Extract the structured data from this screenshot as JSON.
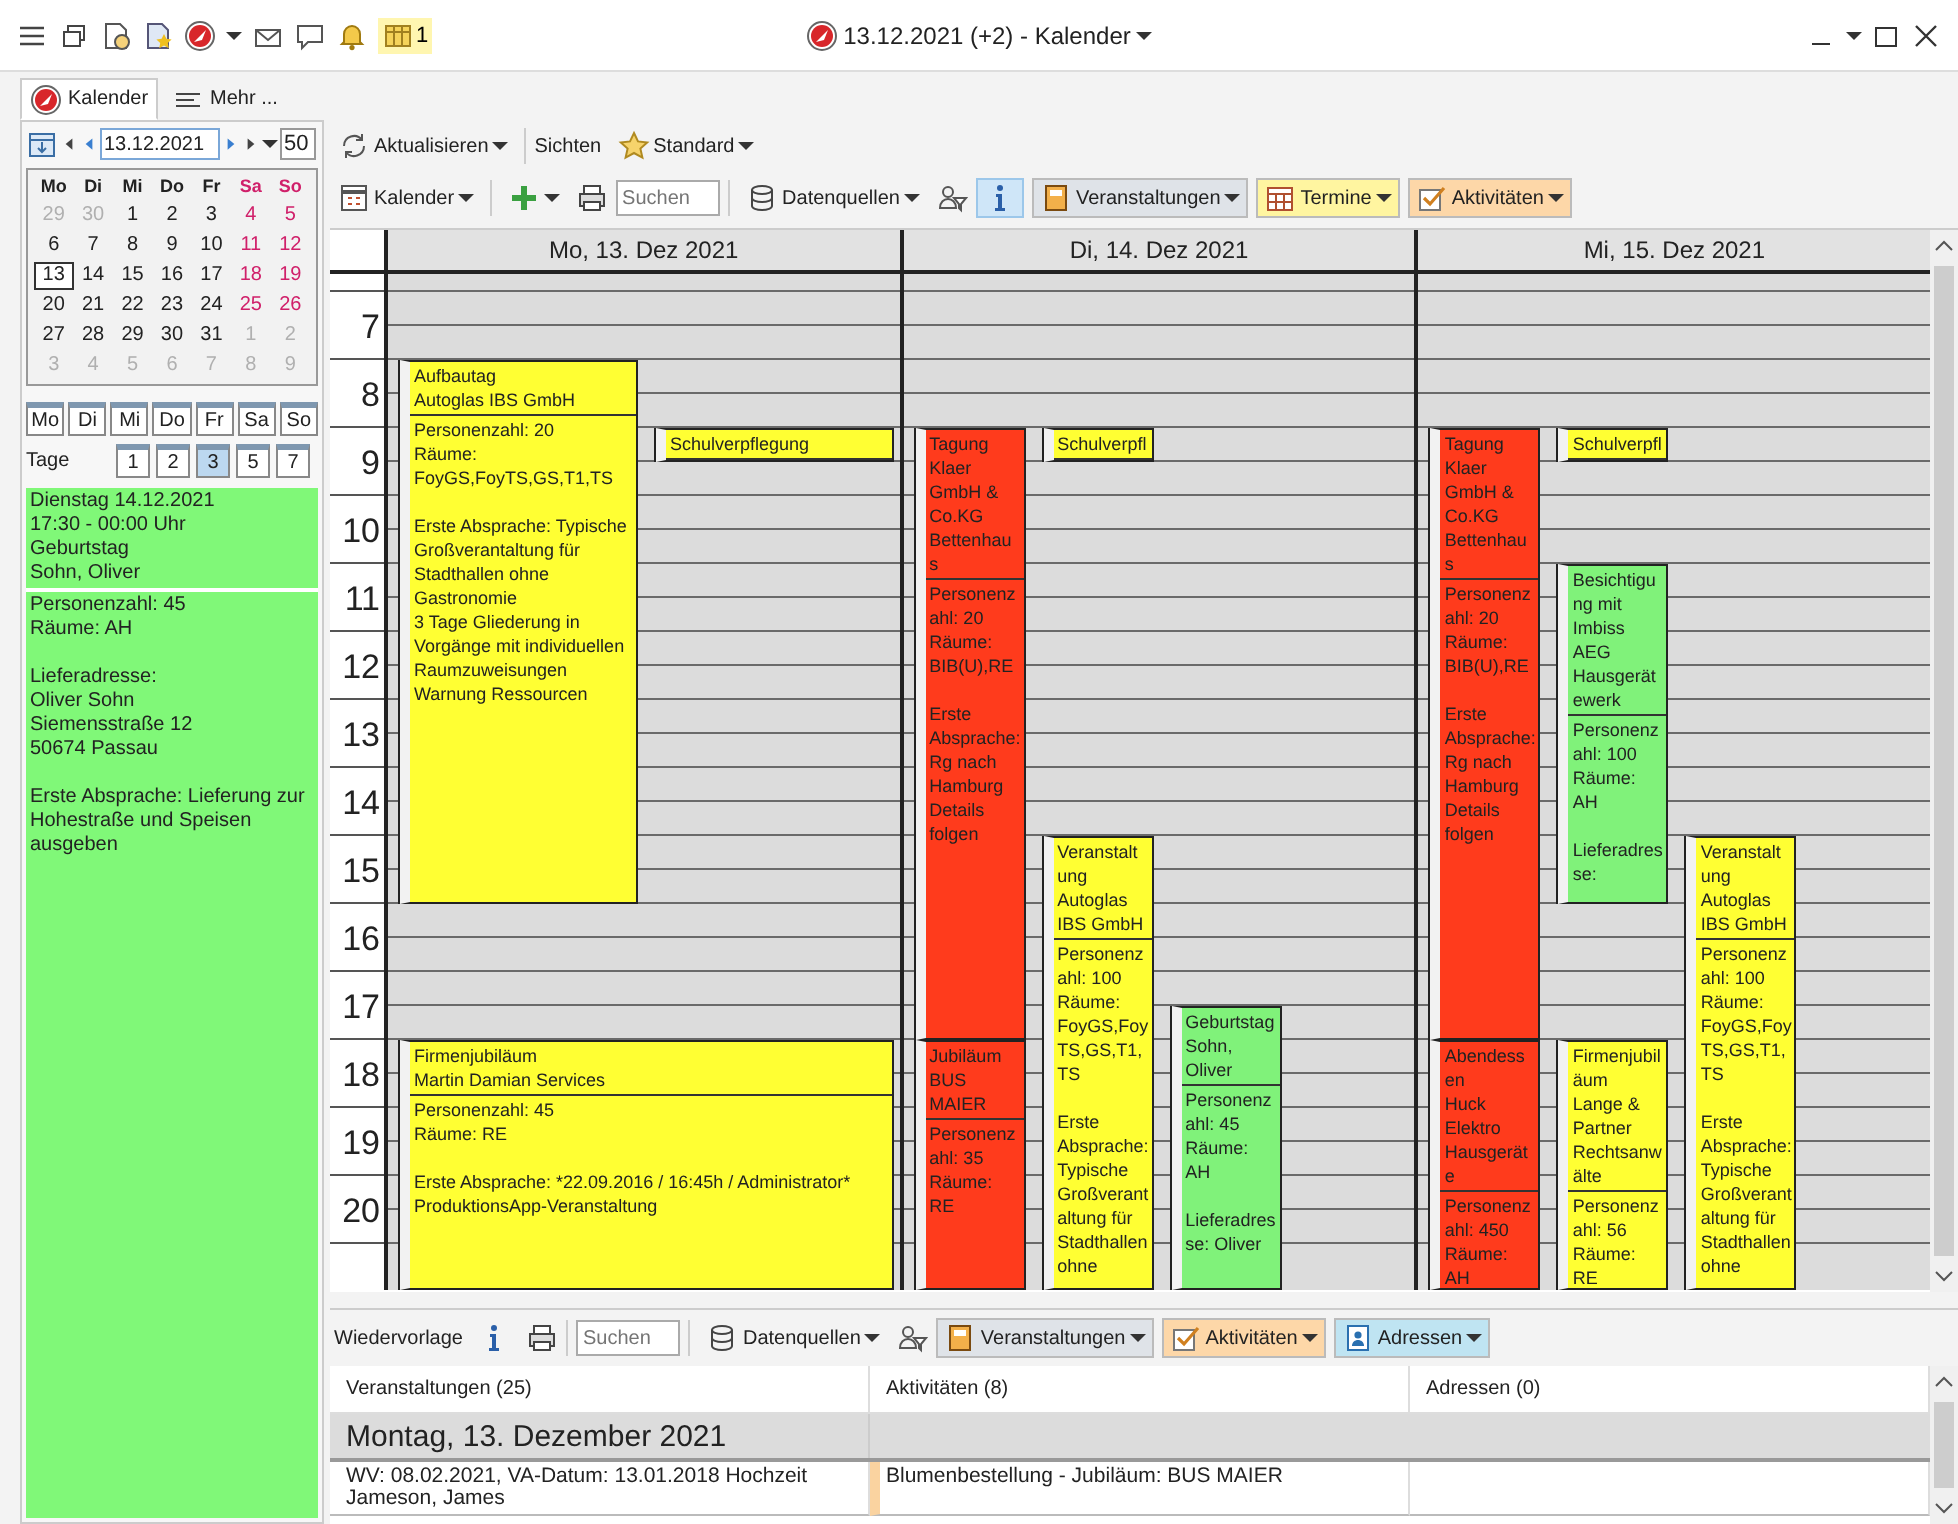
{
  "window": {
    "title": "13.12.2021 (+2) - Kalender",
    "badge": "1"
  },
  "tabs": [
    {
      "label": "Kalender",
      "selected": true
    },
    {
      "label": "Mehr ...",
      "selected": false
    }
  ],
  "navigator": {
    "date": "13.12.2021",
    "count": "50",
    "weekdays": [
      "Mo",
      "Di",
      "Mi",
      "Do",
      "Fr",
      "Sa",
      "So"
    ],
    "weeks": [
      [
        {
          "d": "29",
          "muted": true,
          "selected": false
        },
        {
          "d": "30",
          "muted": true,
          "selected": false
        },
        {
          "d": "1",
          "muted": false,
          "selected": false
        },
        {
          "d": "2",
          "muted": false,
          "selected": false
        },
        {
          "d": "3",
          "muted": false,
          "selected": false
        },
        {
          "d": "4",
          "muted": false,
          "selected": false
        },
        {
          "d": "5",
          "muted": false,
          "selected": false
        }
      ],
      [
        {
          "d": "6",
          "muted": false,
          "selected": false
        },
        {
          "d": "7",
          "muted": false,
          "selected": false
        },
        {
          "d": "8",
          "muted": false,
          "selected": false
        },
        {
          "d": "9",
          "muted": false,
          "selected": false
        },
        {
          "d": "10",
          "muted": false,
          "selected": false
        },
        {
          "d": "11",
          "muted": false,
          "selected": false
        },
        {
          "d": "12",
          "muted": false,
          "selected": false
        }
      ],
      [
        {
          "d": "13",
          "muted": false,
          "selected": true
        },
        {
          "d": "14",
          "muted": false,
          "selected": false
        },
        {
          "d": "15",
          "muted": false,
          "selected": false
        },
        {
          "d": "16",
          "muted": false,
          "selected": false
        },
        {
          "d": "17",
          "muted": false,
          "selected": false
        },
        {
          "d": "18",
          "muted": false,
          "selected": false
        },
        {
          "d": "19",
          "muted": false,
          "selected": false
        }
      ],
      [
        {
          "d": "20",
          "muted": false,
          "selected": false
        },
        {
          "d": "21",
          "muted": false,
          "selected": false
        },
        {
          "d": "22",
          "muted": false,
          "selected": false
        },
        {
          "d": "23",
          "muted": false,
          "selected": false
        },
        {
          "d": "24",
          "muted": false,
          "selected": false
        },
        {
          "d": "25",
          "muted": false,
          "selected": false
        },
        {
          "d": "26",
          "muted": false,
          "selected": false
        }
      ],
      [
        {
          "d": "27",
          "muted": false,
          "selected": false
        },
        {
          "d": "28",
          "muted": false,
          "selected": false
        },
        {
          "d": "29",
          "muted": false,
          "selected": false
        },
        {
          "d": "30",
          "muted": false,
          "selected": false
        },
        {
          "d": "31",
          "muted": false,
          "selected": false
        },
        {
          "d": "1",
          "muted": true,
          "selected": false
        },
        {
          "d": "2",
          "muted": true,
          "selected": false
        }
      ],
      [
        {
          "d": "3",
          "muted": true,
          "selected": false
        },
        {
          "d": "4",
          "muted": true,
          "selected": false
        },
        {
          "d": "5",
          "muted": true,
          "selected": false
        },
        {
          "d": "6",
          "muted": true,
          "selected": false
        },
        {
          "d": "7",
          "muted": true,
          "selected": false
        },
        {
          "d": "8",
          "muted": true,
          "selected": false
        },
        {
          "d": "9",
          "muted": true,
          "selected": false
        }
      ]
    ],
    "day_buttons": [
      {
        "label": "Mo",
        "selected": false
      },
      {
        "label": "Di",
        "selected": false
      },
      {
        "label": "Mi",
        "selected": false
      },
      {
        "label": "Do",
        "selected": false
      },
      {
        "label": "Fr",
        "selected": false
      },
      {
        "label": "Sa",
        "selected": false
      },
      {
        "label": "So",
        "selected": false
      }
    ],
    "days_label": "Tage",
    "day_counts": [
      {
        "label": "1",
        "selected": false
      },
      {
        "label": "2",
        "selected": false
      },
      {
        "label": "3",
        "selected": true
      },
      {
        "label": "5",
        "selected": false
      },
      {
        "label": "7",
        "selected": false
      }
    ]
  },
  "detail": {
    "header": "Dienstag 14.12.2021\n17:30 - 00:00 Uhr\nGeburtstag\nSohn, Oliver",
    "paragraphs": [
      "Personenzahl: 45\nRäume: AH",
      "Lieferadresse:\nOliver Sohn\nSiemensstraße 12\n50674 Passau",
      "Erste Absprache: Lieferung zur Hohestraße und Speisen ausgeben"
    ]
  },
  "toolbar_top": {
    "refresh": "Aktualisieren",
    "views": "Sichten",
    "view": "Standard"
  },
  "toolbar": {
    "calendar": "Kalender",
    "search_placeholder": "Suchen",
    "sources": "Datenquellen",
    "info_on": true,
    "filters": [
      {
        "label": "Veranstaltungen",
        "color": "#dfe3e8"
      },
      {
        "label": "Termine",
        "color": "#fff5a0"
      },
      {
        "label": "Aktivitäten",
        "color": "#fdd7a8"
      }
    ]
  },
  "calendar": {
    "hours": [
      "7",
      "8",
      "9",
      "10",
      "11",
      "12",
      "13",
      "14",
      "15",
      "16",
      "17",
      "18",
      "19",
      "20"
    ],
    "days": [
      {
        "label": "Mo, 13. Dez 2021",
        "lanes": [
          [
            {
              "wide": false,
              "color": "#ffff33",
              "title": "Aufbautag",
              "company": "Autoglas IBS GmbH",
              "notes": [
                "Personenzahl: 20\nRäume: FoyGS,FoyTS,GS,T1,TS",
                "Erste Absprache: Typische Großverantaltung für Stadthallen ohne Gastronomie\n3 Tage Gliederung in Vorgänge mit individuellen Raumzuweisungen Warnung Ressourcen"
              ]
            },
            {
              "wide": true,
              "color": "#ffff33",
              "title": "Firmenjubiläum",
              "company": "Martin Damian Services",
              "notes": [
                "Personenzahl: 45\nRäume: RE",
                "Erste Absprache: *22.09.2016 / 16:45h / Administrator*\nProduktionsApp-Veranstaltung"
              ]
            }
          ],
          [
            {
              "wide": false,
              "color": "#ffff33",
              "title": "Schulverpflegung"
            }
          ]
        ]
      },
      {
        "label": "Di, 14. Dez 2021",
        "lanes": [
          [
            {
              "wide": false,
              "color": "#ff3b1c",
              "title": "Tagung",
              "company": "Klaer GmbH & Co.KG Bettenhaus",
              "notes": [
                "Personenzahl: 20\nRäume: BIB(U),RE",
                "Erste Absprache: Rg nach Hamburg Details folgen"
              ]
            },
            {
              "wide": false,
              "color": "#ff3b1c",
              "title": "Jubiläum",
              "company": "BUS MAIER",
              "notes": [
                "Personenzahl: 35\nRäume: RE"
              ]
            }
          ],
          [
            {
              "wide": false,
              "color": "#ffff33",
              "title": "Schulverpfl"
            },
            {
              "wide": false,
              "color": "#ffff33",
              "title": "Veranstaltung",
              "company": "Autoglas IBS GmbH",
              "notes": [
                "Personenzahl: 100\nRäume: FoyGS,FoyTS,GS,T1,TS",
                "Erste Absprache: Typische Großverantaltung für Stadthallen ohne"
              ]
            }
          ],
          [
            {
              "wide": false,
              "color": "#80f27a",
              "title": "Geburtstag",
              "company": "Sohn, Oliver",
              "notes": [
                "Personenzahl: 45\nRäume: AH",
                "Lieferadresse: Oliver"
              ]
            }
          ]
        ]
      },
      {
        "label": "Mi, 15. Dez 2021",
        "lanes": [
          [
            {
              "wide": false,
              "color": "#ff3b1c",
              "title": "Tagung",
              "company": "Klaer GmbH & Co.KG Bettenhaus",
              "notes": [
                "Personenzahl: 20\nRäume: BIB(U),RE",
                "Erste Absprache: Rg nach Hamburg Details folgen"
              ]
            },
            {
              "wide": false,
              "color": "#ff3b1c",
              "title": "Abendessen",
              "company": "Huck Elektro Hausgeräte",
              "notes": [
                "Personenzahl: 450\nRäume: AH"
              ]
            }
          ],
          [
            {
              "wide": false,
              "color": "#ffff33",
              "title": "Schulverpfl"
            },
            {
              "wide": false,
              "color": "#80f27a",
              "title": "Besichtigung mit Imbiss",
              "company": "AEG Hausgerätewerk",
              "notes": [
                "Personenzahl: 100\nRäume: AH",
                "Lieferadresse:"
              ]
            },
            {
              "wide": false,
              "color": "#ffff33",
              "title": "Firmenjubiläum",
              "company": "Lange & Partner Rechtsanwälte",
              "notes": [
                "Personenzahl: 56\nRäume: RE"
              ]
            }
          ],
          [
            {
              "wide": false,
              "color": "#ffff33",
              "title": "Veranstaltung",
              "company": "Autoglas IBS GmbH",
              "notes": [
                "Personenzahl: 100\nRäume: FoyGS,FoyTS,GS,T1,TS",
                "Erste Absprache: Typische Großverantaltung für Stadthallen ohne"
              ]
            }
          ]
        ]
      }
    ]
  },
  "bottom": {
    "title": "Wiedervorlage",
    "search_placeholder": "Suchen",
    "sources": "Datenquellen",
    "info_on": false,
    "filters": [
      {
        "label": "Veranstaltungen",
        "color": "#dfe3e8"
      },
      {
        "label": "Aktivitäten",
        "color": "#fdd7a8"
      },
      {
        "label": "Adressen",
        "color": "#bfe4f2"
      }
    ],
    "columns": [
      "Veranstaltungen (25)",
      "Aktivitäten (8)",
      "Adressen (0)"
    ],
    "group": "Montag, 13. Dezember 2021",
    "rows": [
      {
        "cells": [
          "WV: 08.02.2021, VA-Datum: 13.01.2018 Hochzeit\nJameson, James",
          "Blumenbestellung - Jubiläum: BUS MAIER"
        ]
      }
    ]
  }
}
